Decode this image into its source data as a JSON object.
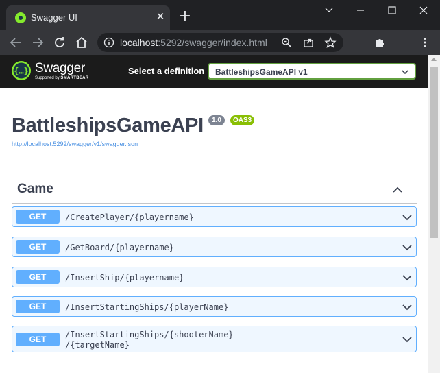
{
  "browser": {
    "tab_title": "Swagger UI",
    "close_glyph": "✕",
    "new_tab_glyph": "+",
    "url_host": "localhost",
    "url_rest": ":5292/swagger/index.html"
  },
  "swagger": {
    "brand": "Swagger",
    "tagline_prefix": "Supported by",
    "tagline_brand": "SMARTBEAR",
    "definition_label": "Select a definition",
    "definition_value": "BattleshipsGameAPI v1"
  },
  "api": {
    "title": "BattleshipsGameAPI",
    "version": "1.0",
    "oas_badge": "OAS3",
    "spec_url": "http://localhost:5292/swagger/v1/swagger.json"
  },
  "tag": {
    "name": "Game"
  },
  "operations": [
    {
      "method": "GET",
      "path": "/CreatePlayer/{playername}"
    },
    {
      "method": "GET",
      "path": "/GetBoard/{playername}"
    },
    {
      "method": "GET",
      "path": "/InsertShip/{playername}"
    },
    {
      "method": "GET",
      "path": "/InsertStartingShips/{playerName}"
    },
    {
      "method": "GET",
      "path_line1": "/InsertStartingShips/{shooterName}",
      "path_line2": "/{targetName}"
    }
  ],
  "colors": {
    "get_method": "#61affe",
    "swagger_green": "#85ea2d",
    "oas_badge": "#89bf04",
    "version_badge": "#7d8492",
    "text": "#3b4151"
  }
}
